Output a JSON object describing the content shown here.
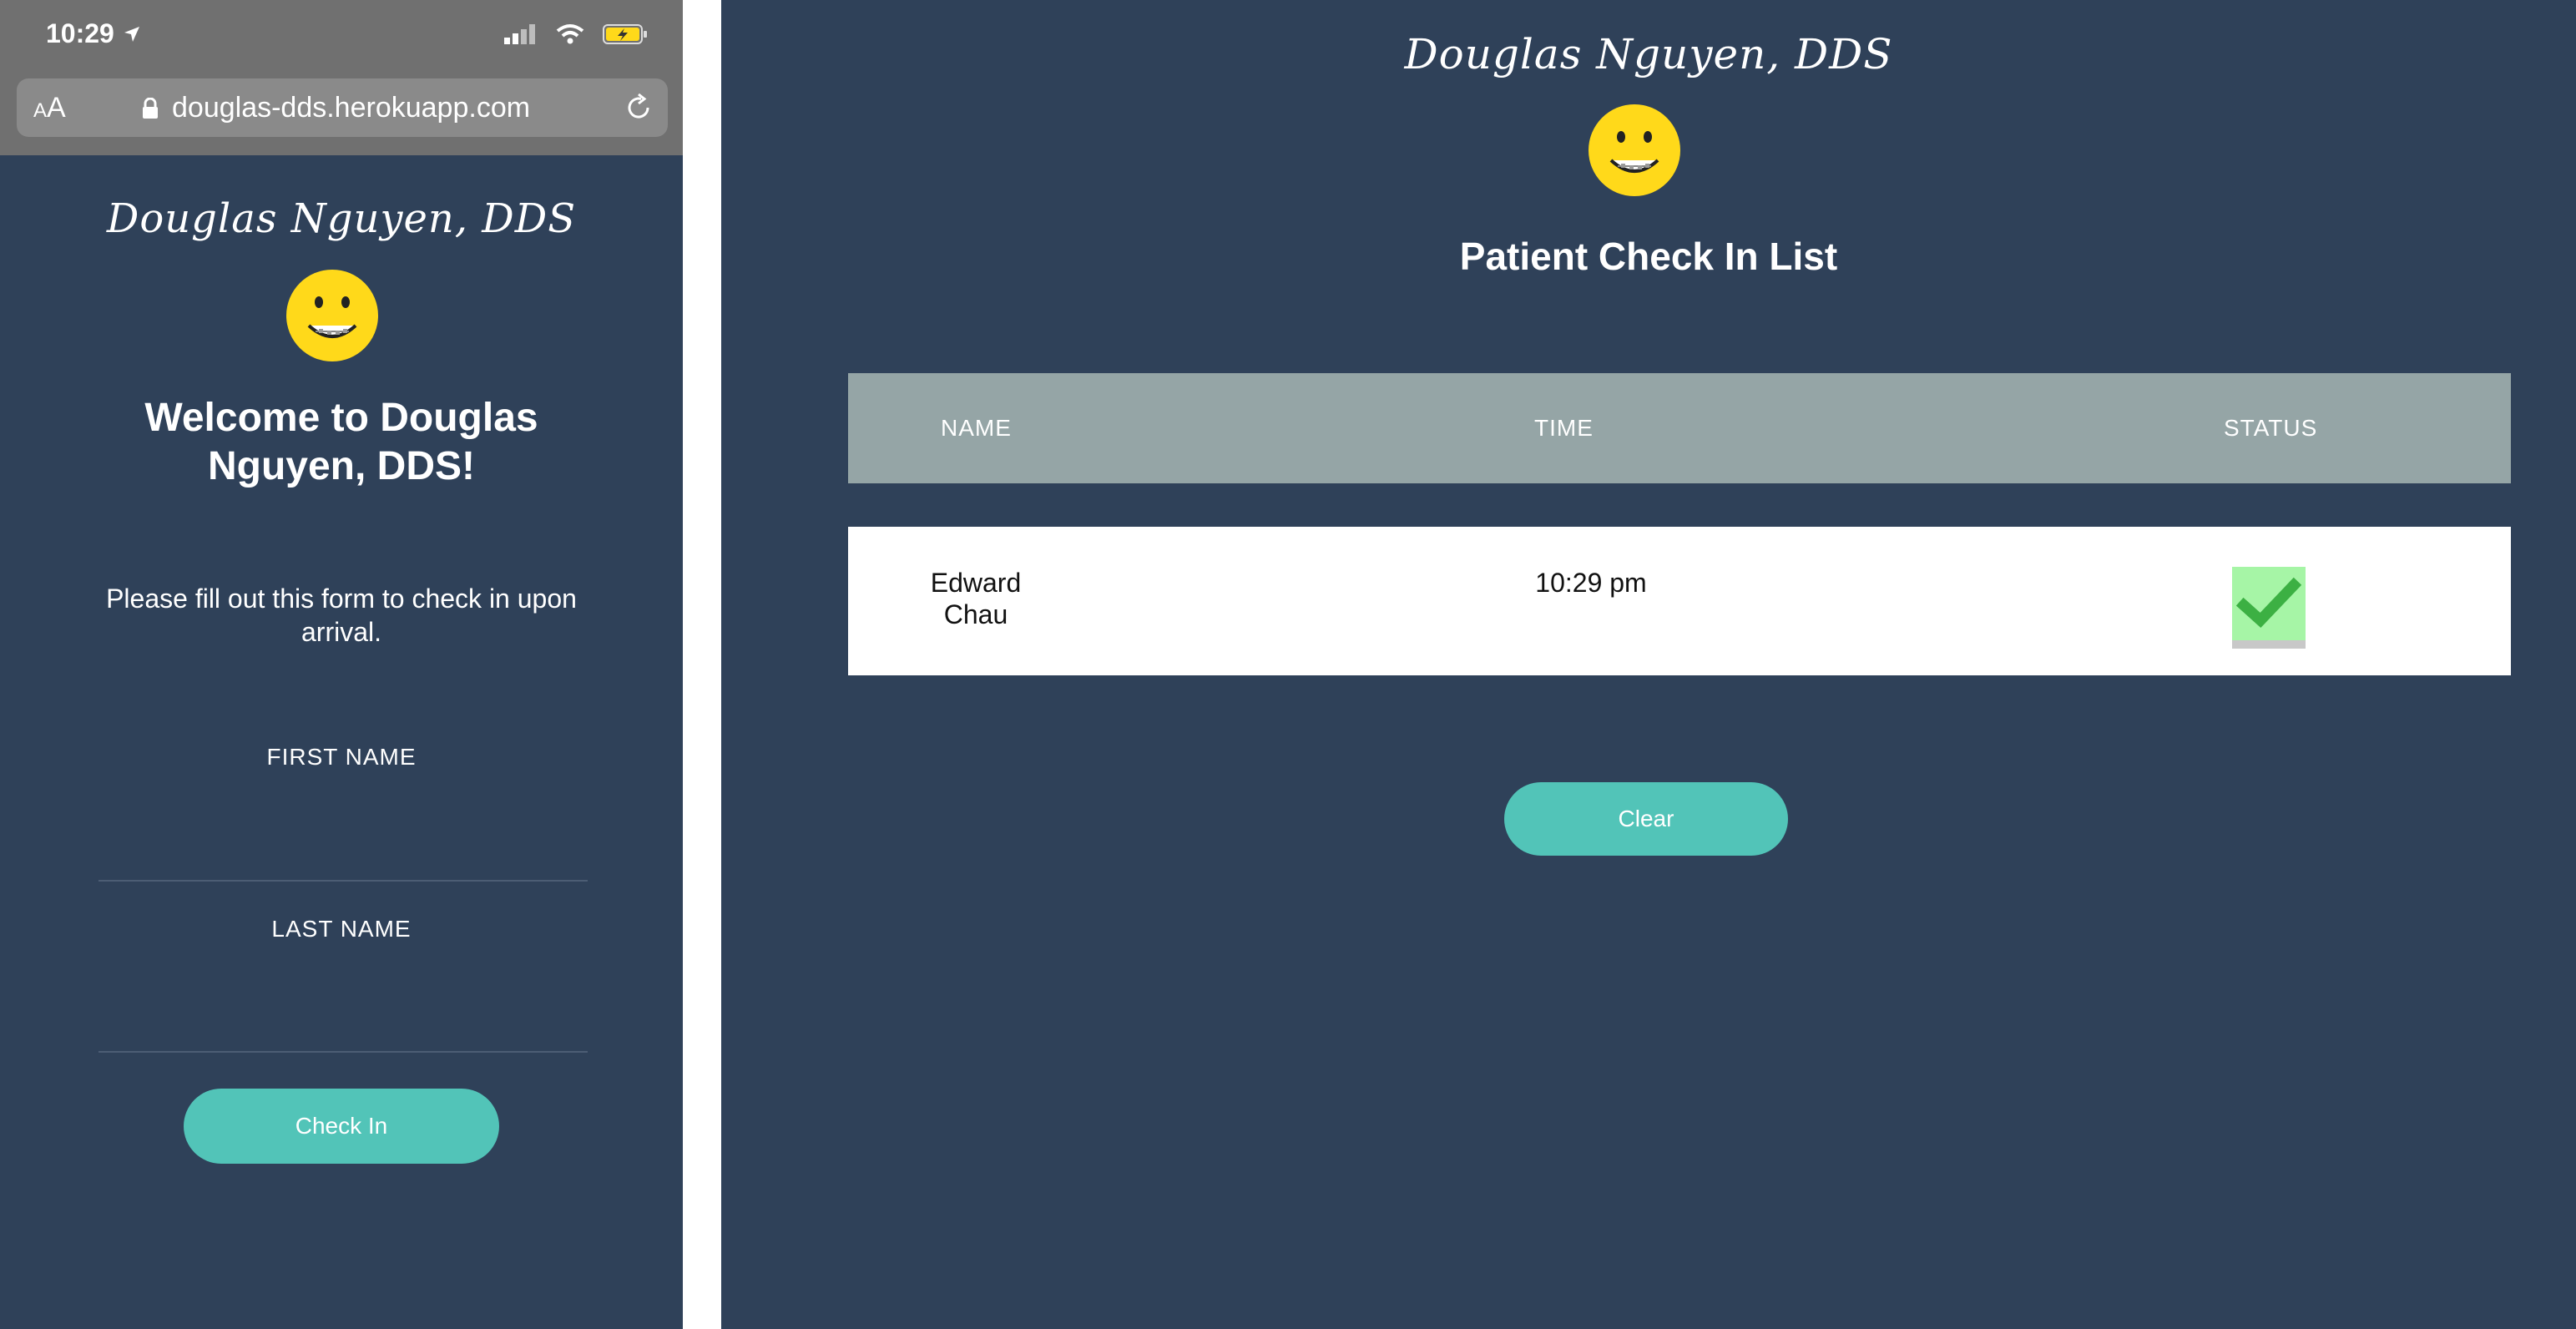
{
  "phone": {
    "status_bar": {
      "time": "10:29"
    },
    "browser": {
      "text_size_small": "A",
      "text_size_large": "A",
      "url": "douglas-dds.herokuapp.com"
    },
    "logo_text": "Douglas Nguyen, DDS",
    "welcome_line1": "Welcome to Douglas",
    "welcome_line2": "Nguyen, DDS!",
    "instructions_line1": "Please fill out this form to check in upon",
    "instructions_line2": "arrival.",
    "form": {
      "first_name_label": "FIRST NAME",
      "first_name_value": "",
      "last_name_label": "LAST NAME",
      "last_name_value": "",
      "submit_label": "Check In"
    }
  },
  "dashboard": {
    "logo_text": "Douglas Nguyen, DDS",
    "title": "Patient Check In List",
    "table": {
      "headers": [
        "NAME",
        "TIME",
        "STATUS"
      ],
      "rows": [
        {
          "name_first": "Edward",
          "name_last": "Chau",
          "time": "10:29 pm",
          "status": "checked"
        }
      ]
    },
    "clear_label": "Clear"
  },
  "colors": {
    "background": "#2f4159",
    "accent": "#52c4b8",
    "table_header": "#95a5a6",
    "smiley": "#ffd91a",
    "check": "#3cb043"
  }
}
